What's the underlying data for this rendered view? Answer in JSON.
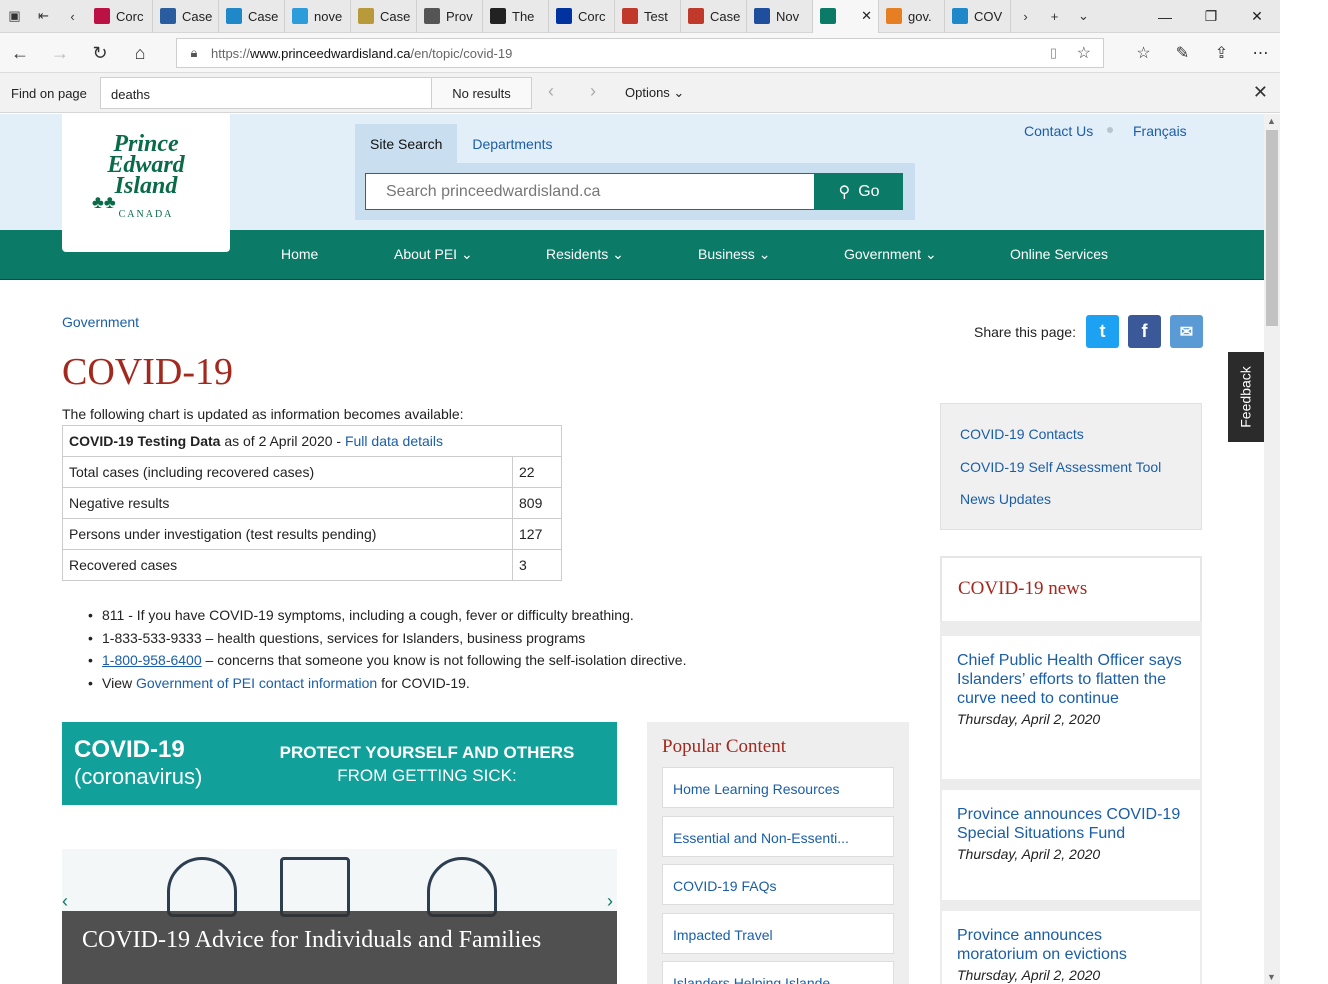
{
  "browser": {
    "tabs": [
      {
        "label": "Corc",
        "fav": "#b14"
      },
      {
        "label": "Case",
        "fav": "#2a5d9f"
      },
      {
        "label": "Case",
        "fav": "#1e88c8"
      },
      {
        "label": "nove",
        "fav": "#2d9cdb"
      },
      {
        "label": "Case",
        "fav": "#b89a3a"
      },
      {
        "label": "Prov",
        "fav": "#555"
      },
      {
        "label": "The",
        "fav": "#222"
      },
      {
        "label": "Corc",
        "fav": "#0033a0"
      },
      {
        "label": "Test",
        "fav": "#c0392b"
      },
      {
        "label": "Case",
        "fav": "#c0392b"
      },
      {
        "label": "Nov",
        "fav": "#1f4e9c"
      },
      {
        "label": "",
        "fav": "#0b7a66"
      },
      {
        "label": "gov.",
        "fav": "#e67e22"
      },
      {
        "label": "COV",
        "fav": "#1e88c8"
      }
    ],
    "url_prefix": "https://",
    "url_host": "www.princeedwardisland.ca",
    "url_path": "/en/topic/covid-19"
  },
  "find": {
    "label": "Find on page",
    "query": "deaths",
    "result": "No results",
    "options": "Options"
  },
  "header": {
    "logo_line1": "Prince",
    "logo_line2": "Edward",
    "logo_line3": "Island",
    "logo_canada": "CANADA",
    "search_tab": "Site Search",
    "departments_tab": "Departments",
    "search_placeholder": "Search princeedwardisland.ca",
    "go_label": "Go",
    "contact": "Contact Us",
    "francais": "Français"
  },
  "nav": [
    "Home",
    "About PEI",
    "Residents",
    "Business",
    "Government",
    "Online Services"
  ],
  "content": {
    "breadcrumb": "Government",
    "title": "COVID-19",
    "share_label": "Share this page:",
    "intro": "The following chart is updated as information becomes available:",
    "table_caption_bold": "COVID-19 Testing Data",
    "table_caption_rest": " as of 2 April 2020 - ",
    "table_caption_link": "Full data details",
    "rows": [
      {
        "label": "Total cases (including recovered cases)",
        "value": "22"
      },
      {
        "label": "Negative results",
        "value": "809"
      },
      {
        "label": "Persons under investigation (test results pending)",
        "value": "127"
      },
      {
        "label": "Recovered cases",
        "value": "3"
      }
    ],
    "bullet1": "811 - If you have COVID-19 symptoms, including a cough, fever or difficulty breathing.",
    "bullet2": "1-833-533-9333 – health questions, services for Islanders, business programs",
    "bullet3_link": "1-800-958-6400",
    "bullet3_rest": " – concerns that someone you know is not following the self-isolation directive.",
    "bullet4_pre": "View ",
    "bullet4_link": "Government of PEI contact information",
    "bullet4_post": " for COVID-19."
  },
  "banner": {
    "line1": "COVID-19",
    "line2": "(coronavirus)",
    "line3a": "PROTECT YOURSELF AND OTHERS",
    "line3b": "FROM GETTING SICK:"
  },
  "carousel_caption": "COVID-19 Advice for Individuals and Families",
  "popular": {
    "title": "Popular Content",
    "items": [
      "Home Learning Resources",
      "Essential and Non-Essenti...",
      "COVID-19 FAQs",
      "Impacted Travel",
      "Islanders Helping Islande..."
    ]
  },
  "sidebar_links": [
    "COVID-19 Contacts",
    "COVID-19 Self Assessment Tool",
    "News Updates"
  ],
  "news": {
    "title": "COVID-19 news",
    "items": [
      {
        "title": "Chief Public Health Officer says Islanders’ efforts to flatten the curve need to continue",
        "date": "Thursday, April 2, 2020"
      },
      {
        "title": "Province announces COVID-19 Special Situations Fund",
        "date": "Thursday, April 2, 2020"
      },
      {
        "title": "Province announces moratorium on evictions",
        "date": "Thursday, April 2, 2020"
      }
    ]
  },
  "feedback": "Feedback",
  "colors": {
    "brand_green": "#0b7a66",
    "title_red": "#a3281e",
    "link_blue": "#1a5ea8"
  }
}
